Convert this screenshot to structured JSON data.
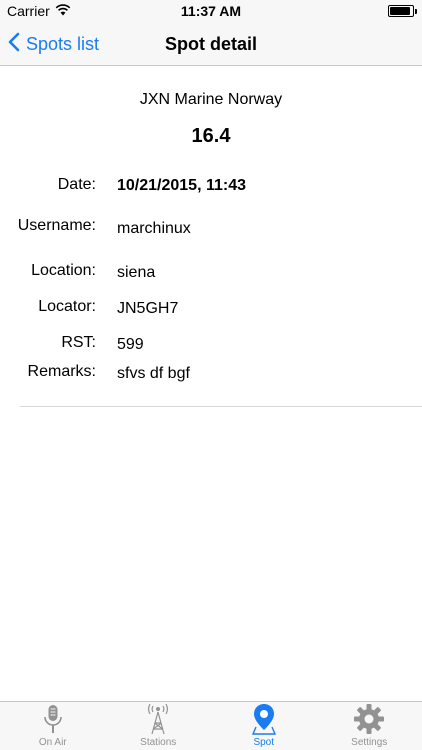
{
  "status_bar": {
    "carrier": "Carrier",
    "time": "11:37 AM",
    "battery_level": 0.9
  },
  "nav": {
    "back_label": "Spots list",
    "title": "Spot detail"
  },
  "spot": {
    "station": "JXN Marine Norway",
    "frequency": "16.4",
    "fields": [
      {
        "label": "Date:",
        "value": "10/21/2015, 11:43"
      },
      {
        "label": "Username:",
        "value": "marchinux"
      },
      {
        "label": "Location:",
        "value": "siena"
      },
      {
        "label": "Locator:",
        "value": "JN5GH7"
      },
      {
        "label": "RST:",
        "value": "599"
      },
      {
        "label": "Remarks:",
        "value": "sfvs df bgf"
      }
    ]
  },
  "tabs": [
    {
      "label": "On Air",
      "icon": "microphone-icon",
      "active": false
    },
    {
      "label": "Stations",
      "icon": "antenna-tower-icon",
      "active": false
    },
    {
      "label": "Spot",
      "icon": "map-pin-icon",
      "active": true
    },
    {
      "label": "Settings",
      "icon": "gear-icon",
      "active": false
    }
  ],
  "colors": {
    "accent": "#1a7cf0",
    "inactive": "#929292"
  }
}
